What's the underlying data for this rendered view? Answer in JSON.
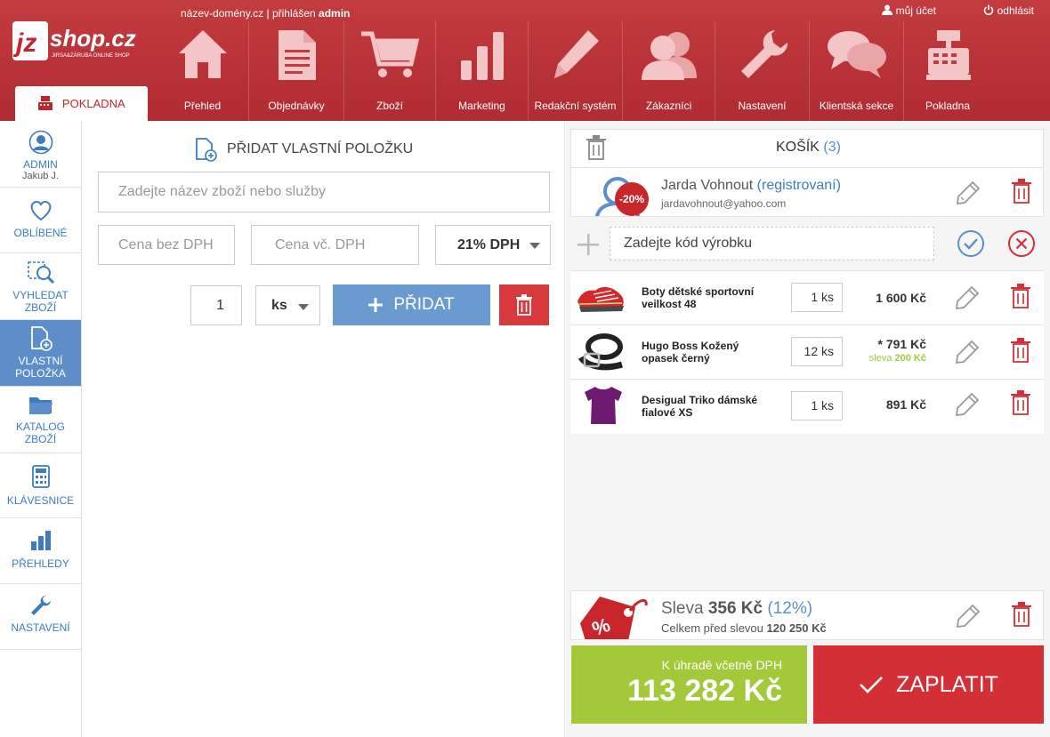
{
  "header": {
    "logo_text": "jzshop.cz",
    "logo_subtext": "JIRSA&ZÁRUBA ONLINE SHOP",
    "domain": "název-domény.cz",
    "separator": "|",
    "logged_in_label": "přihlášen",
    "user": "admin",
    "my_account": "můj účet",
    "logout": "odhlásit",
    "active_tab": "POKLADNA",
    "nav": [
      {
        "label": "Přehled",
        "icon": "home-icon"
      },
      {
        "label": "Objednávky",
        "icon": "document-icon"
      },
      {
        "label": "Zboží",
        "icon": "cart-icon"
      },
      {
        "label": "Marketing",
        "icon": "bar-chart-icon"
      },
      {
        "label": "Redakční systém",
        "icon": "pencil-icon"
      },
      {
        "label": "Zákazníci",
        "icon": "users-icon"
      },
      {
        "label": "Nastavení",
        "icon": "wrench-icon"
      },
      {
        "label": "Klientská sekce",
        "icon": "chat-icon"
      },
      {
        "label": "Pokladna",
        "icon": "cash-register-icon"
      }
    ]
  },
  "sidebar": {
    "admin_label": "ADMIN",
    "admin_name": "Jakub J.",
    "items": [
      {
        "line1": "OBLÍBENÉ",
        "line2": ""
      },
      {
        "line1": "VYHLEDAT",
        "line2": "ZBOŽÍ"
      },
      {
        "line1": "VLASTNÍ",
        "line2": "POLOŽKA"
      },
      {
        "line1": "KATALOG",
        "line2": "ZBOŽÍ"
      },
      {
        "line1": "KLÁVESNICE",
        "line2": ""
      },
      {
        "line1": "PŘEHLEDY",
        "line2": ""
      },
      {
        "line1": "NASTAVENÍ",
        "line2": ""
      }
    ]
  },
  "custom_item": {
    "title": "PŘIDAT VLASTNÍ POLOŽKU",
    "name_placeholder": "Zadejte název zboží nebo služby",
    "price_net_placeholder": "Cena bez DPH",
    "price_gross_placeholder": "Cena vč. DPH",
    "vat_selected": "21% DPH",
    "quantity": "1",
    "unit_selected": "ks",
    "add_button": "PŘIDAT"
  },
  "cart": {
    "title": "KOŠÍK",
    "count": "(3)",
    "customer": {
      "name": "Jarda Vohnout",
      "status": "(registrovaní)",
      "email": "jardavohnout@yahoo.com",
      "discount_badge": "-20%"
    },
    "code_placeholder": "Zadejte kód výrobku",
    "items": [
      {
        "name": "Boty dětské sportovní veilkost 48",
        "qty": "1 ks",
        "price": "1 600 Kč",
        "discount_label": "",
        "discount_value": ""
      },
      {
        "name": "Hugo Boss Kožený opasek černý",
        "qty": "12 ks",
        "price": "* 791 Kč",
        "discount_label": "sleva",
        "discount_value": "200 Kč"
      },
      {
        "name": "Desigual Triko dámské fialové XS",
        "qty": "1 ks",
        "price": "891 Kč",
        "discount_label": "",
        "discount_value": ""
      }
    ],
    "discount": {
      "label": "Sleva",
      "amount": "356 Kč",
      "percent": "(12%)",
      "before_label": "Celkem před slevou",
      "before_amount": "120 250 Kč",
      "tag_text": "%"
    },
    "total_label": "K úhradě včetně DPH",
    "total": "113 282 Kč",
    "pay_button": "ZAPLATIT"
  },
  "colors": {
    "brand_red": "#c0272d",
    "blue": "#5d8ec9",
    "green": "#a3c839",
    "pay_red": "#d32f35"
  }
}
